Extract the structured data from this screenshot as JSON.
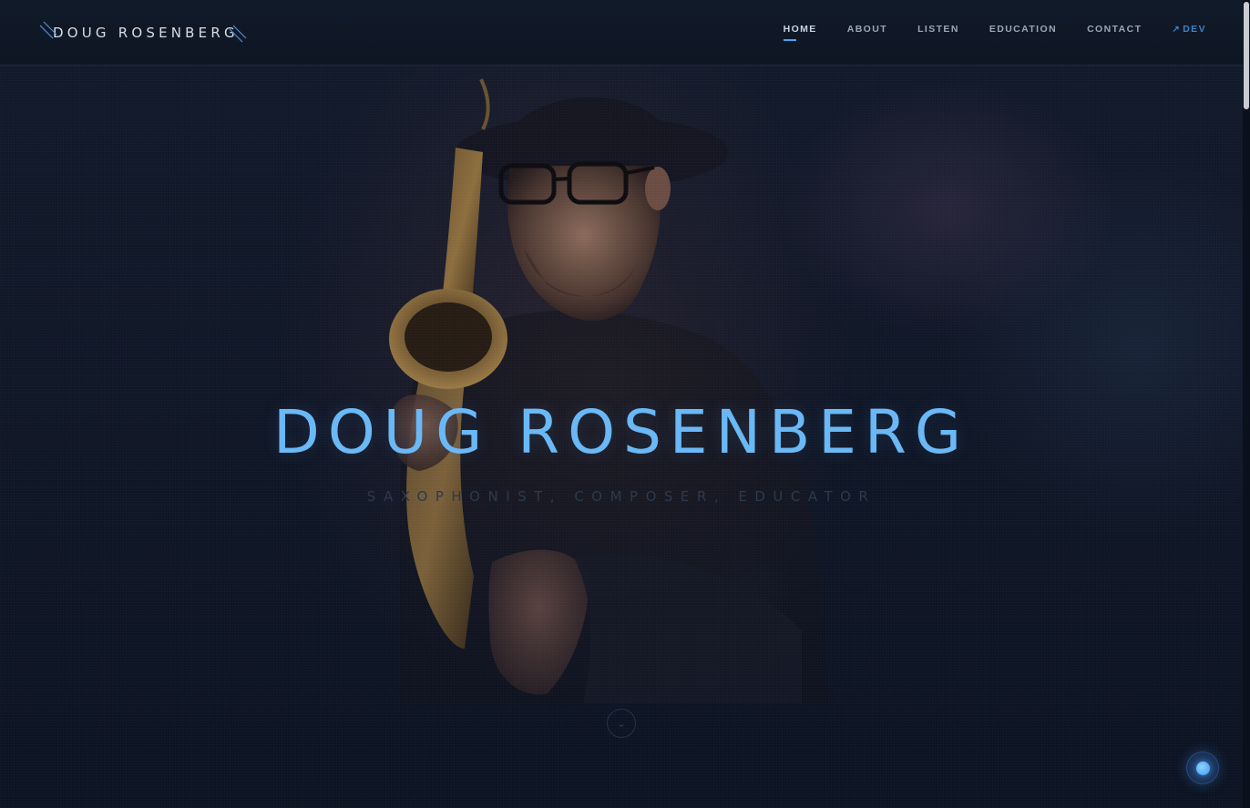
{
  "header": {
    "brand": "DOUG ROSENBERG",
    "nav": [
      {
        "label": "HOME",
        "active": true
      },
      {
        "label": "ABOUT",
        "active": false
      },
      {
        "label": "LISTEN",
        "active": false
      },
      {
        "label": "EDUCATION",
        "active": false
      },
      {
        "label": "CONTACT",
        "active": false
      },
      {
        "label": "DEV",
        "active": false,
        "external": true
      }
    ]
  },
  "hero": {
    "title": "DOUG ROSENBERG",
    "subtitle": "SAXOPHONIST, COMPOSER, EDUCATOR",
    "scroll_icon": "chevron-down-icon"
  },
  "fab": {
    "icon": "audio-player-dot-icon"
  },
  "colors": {
    "accent": "#6ab8f5",
    "nav_active_underline": "#4aa3f0",
    "dev_link": "#3f82c8",
    "background": "#0c1220"
  }
}
